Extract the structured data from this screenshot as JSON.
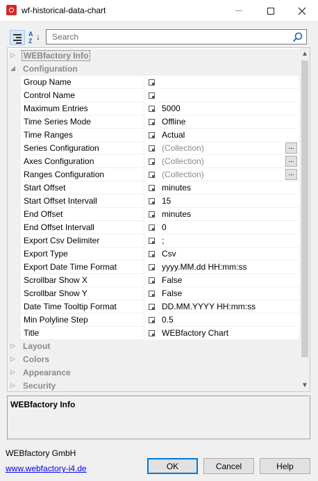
{
  "window": {
    "title": "wf-historical-data-chart",
    "controls": {
      "minimize": "minimize",
      "maximize": "maximize",
      "close": "close"
    }
  },
  "toolbar": {
    "categorized_icon": "categorized-view-icon",
    "alphabetical_icon": "alphabetical-sort-icon",
    "search_placeholder": "Search"
  },
  "grid": {
    "categories": [
      {
        "label": "WEBfactory Info",
        "expanded": false,
        "selected": true
      },
      {
        "label": "Configuration",
        "expanded": true,
        "selected": false
      },
      {
        "label": "Layout",
        "expanded": false,
        "selected": false
      },
      {
        "label": "Colors",
        "expanded": false,
        "selected": false
      },
      {
        "label": "Appearance",
        "expanded": false,
        "selected": false
      },
      {
        "label": "Security",
        "expanded": false,
        "selected": false
      }
    ],
    "properties": [
      {
        "name": "Group Name",
        "value": "",
        "collection": false
      },
      {
        "name": "Control Name",
        "value": "",
        "collection": false
      },
      {
        "name": "Maximum Entries",
        "value": "5000",
        "collection": false
      },
      {
        "name": "Time Series Mode",
        "value": "Offline",
        "collection": false
      },
      {
        "name": "Time Ranges",
        "value": "Actual",
        "collection": false
      },
      {
        "name": "Series Configuration",
        "value": "(Collection)",
        "collection": true
      },
      {
        "name": "Axes Configuration",
        "value": "(Collection)",
        "collection": true
      },
      {
        "name": "Ranges Configuration",
        "value": "(Collection)",
        "collection": true
      },
      {
        "name": "Start Offset",
        "value": "minutes",
        "collection": false
      },
      {
        "name": "Start Offset Intervall",
        "value": "15",
        "collection": false
      },
      {
        "name": "End Offset",
        "value": "minutes",
        "collection": false
      },
      {
        "name": "End Offset Intervall",
        "value": "0",
        "collection": false
      },
      {
        "name": "Export Csv Delimiter",
        "value": ";",
        "collection": false
      },
      {
        "name": "Export Type",
        "value": "Csv",
        "collection": false
      },
      {
        "name": "Export Date Time Format",
        "value": "yyyy.MM.dd HH:mm:ss",
        "collection": false
      },
      {
        "name": "Scrollbar Show X",
        "value": "False",
        "collection": false
      },
      {
        "name": "Scrollbar Show Y",
        "value": "False",
        "collection": false
      },
      {
        "name": "Date Time Tooltip Format",
        "value": "DD.MM.YYYY HH:mm:ss",
        "collection": false
      },
      {
        "name": "Min Polyline Step",
        "value": "0.5",
        "collection": false
      },
      {
        "name": "Title",
        "value": "WEBfactory Chart",
        "collection": false
      }
    ],
    "ellipsis_label": "..."
  },
  "description": {
    "title": "WEBfactory Info"
  },
  "footer": {
    "company": "WEBfactory GmbH",
    "link": "www.webfactory-i4.de",
    "ok_label": "OK",
    "cancel_label": "Cancel",
    "help_label": "Help"
  },
  "colors": {
    "accent": "#0078d7",
    "icon_red": "#d42a2a",
    "link": "#0000ee"
  }
}
